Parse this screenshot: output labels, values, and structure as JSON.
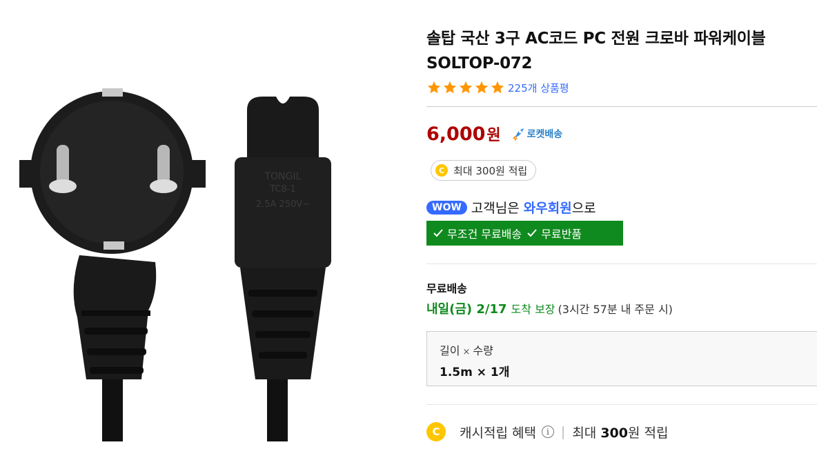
{
  "product": {
    "title": "솔탑 국산 3구 AC코드 PC 전원 크로바 파워케이블 SOLTOP-072",
    "rating_stars": 5,
    "review_count": "225개 상품평",
    "price": "6,000",
    "price_unit": "원",
    "rocket_label": "로켓배송",
    "cash_pill": "최대 300원 적립",
    "image_plug_texts": [
      "TC8-1",
      "TONGIL",
      "2.5A 250V~"
    ]
  },
  "wow": {
    "badge": "WOW",
    "text_prefix": "고객님은 ",
    "text_strong": "와우회원",
    "text_suffix": "으로",
    "benefit1": "무조건 무료배송",
    "benefit2": "무료반품"
  },
  "shipping": {
    "label": "무료배송",
    "date": "내일(금) 2/17",
    "guarantee": "도착 보장",
    "note": "(3시간 57분 내 주문 시)"
  },
  "option": {
    "head1": "길이",
    "times": "×",
    "head2": "수량",
    "value": "1.5m × 1개"
  },
  "cash_benefit": {
    "coin": "C",
    "label": "캐시적립 혜택",
    "info": "i",
    "separator": "|",
    "max_prefix": "최대 ",
    "max_amount": "300",
    "max_suffix": "원 적립"
  },
  "colors": {
    "price": "#ae0000",
    "wow_blue": "#346aff",
    "green": "#0f8a1e",
    "star": "#ff9600"
  }
}
